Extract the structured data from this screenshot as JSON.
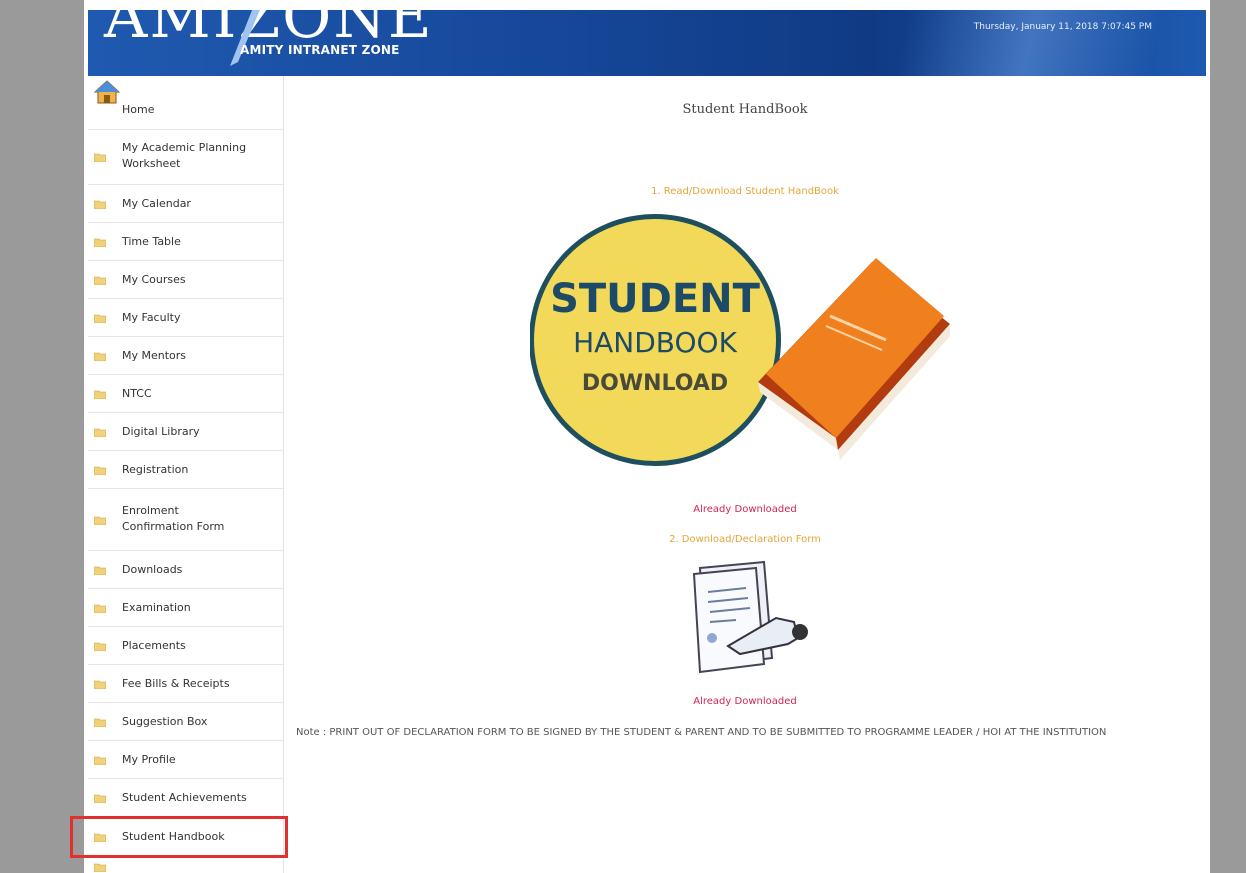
{
  "header": {
    "logo_text": "AMIZONE",
    "logo_subtitle": "AMITY INTRANET ZONE",
    "datetime": "Thursday, January 11, 2018 7:07:45 PM"
  },
  "sidebar": {
    "items": [
      {
        "label": "Home",
        "icon": "home-icon"
      },
      {
        "label": "My Academic Planning Worksheet",
        "icon": "folder-icon"
      },
      {
        "label": "My Calendar",
        "icon": "folder-icon"
      },
      {
        "label": "Time Table",
        "icon": "folder-icon"
      },
      {
        "label": "My Courses",
        "icon": "folder-icon"
      },
      {
        "label": "My Faculty",
        "icon": "folder-icon"
      },
      {
        "label": "My Mentors",
        "icon": "folder-icon"
      },
      {
        "label": "NTCC",
        "icon": "folder-icon"
      },
      {
        "label": "Digital Library",
        "icon": "folder-icon"
      },
      {
        "label": "Registration",
        "icon": "folder-icon"
      },
      {
        "label": "Enrolment Confirmation Form",
        "icon": "folder-icon"
      },
      {
        "label": "Downloads",
        "icon": "folder-icon"
      },
      {
        "label": "Examination",
        "icon": "folder-icon"
      },
      {
        "label": "Placements",
        "icon": "folder-icon"
      },
      {
        "label": "Fee Bills & Receipts",
        "icon": "folder-icon"
      },
      {
        "label": "Suggestion Box",
        "icon": "folder-icon"
      },
      {
        "label": "My Profile",
        "icon": "folder-icon"
      },
      {
        "label": "Student Achievements",
        "icon": "folder-icon"
      },
      {
        "label": "Student Handbook",
        "icon": "folder-icon",
        "selected": true
      }
    ]
  },
  "main": {
    "title": "Student HandBook",
    "step1_link": "1. Read/Download Student HandBook",
    "handbook_art": {
      "line1": "STUDENT",
      "line2": "HANDBOOK",
      "line3": "DOWNLOAD"
    },
    "status1": "Already Downloaded",
    "step2_link": "2. Download/Declaration Form",
    "status2": "Already Downloaded",
    "note": "Note : PRINT OUT OF DECLARATION FORM TO BE SIGNED BY THE STUDENT & PARENT AND TO BE SUBMITTED TO PROGRAMME LEADER / HOI AT THE INSTITUTION"
  },
  "colors": {
    "header_blue": "#16489a",
    "link_orange": "#e4a637",
    "status_red": "#d1264f",
    "highlight_red": "#e03030",
    "badge_yellow": "#f3d95a",
    "book_orange": "#f0801e"
  }
}
